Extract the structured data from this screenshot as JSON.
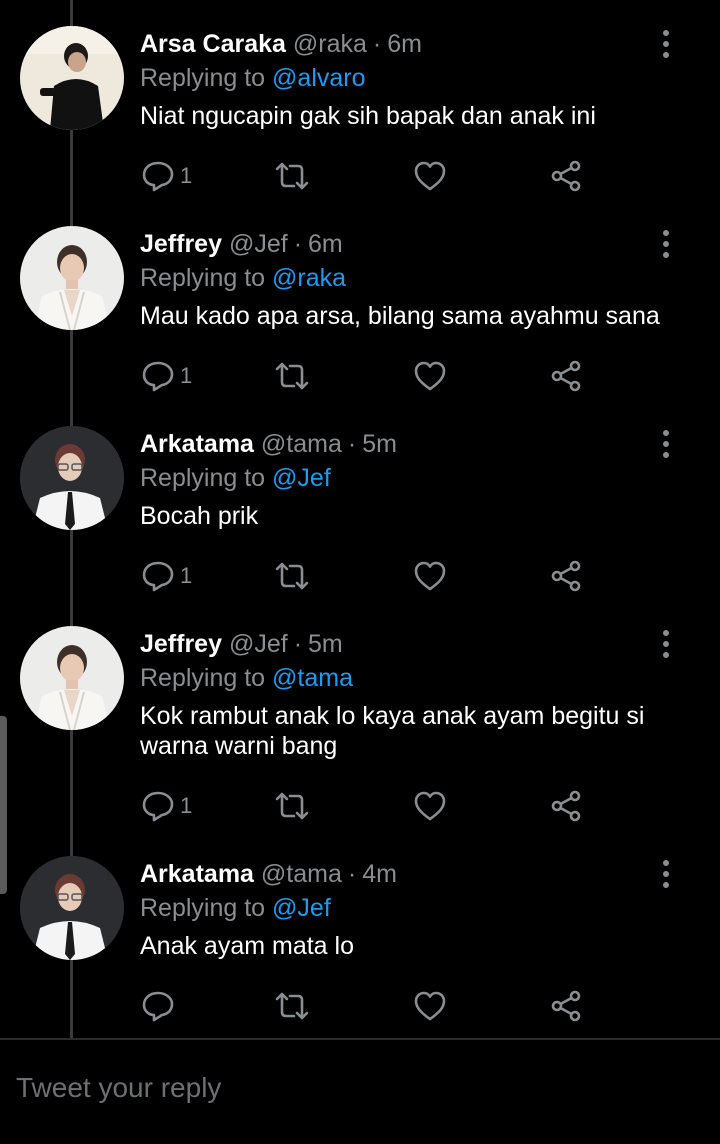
{
  "tweets": [
    {
      "name": "Arsa Caraka",
      "handle": "@raka",
      "time": "6m",
      "reply_prefix": "Replying to",
      "reply_to": "@alvaro",
      "text": "Niat ngucapin gak sih bapak dan anak ini",
      "reply_count": "1",
      "avatar": "photo-dark"
    },
    {
      "name": "Jeffrey",
      "handle": "@Jef",
      "time": "6m",
      "reply_prefix": "Replying to",
      "reply_to": "@raka",
      "text": "Mau kado apa arsa, bilang sama ayahmu sana",
      "reply_count": "1",
      "avatar": "photo-light"
    },
    {
      "name": "Arkatama",
      "handle": "@tama",
      "time": "5m",
      "reply_prefix": "Replying to",
      "reply_to": "@Jef",
      "text": "Bocah prik",
      "reply_count": "1",
      "avatar": "photo-suit"
    },
    {
      "name": "Jeffrey",
      "handle": "@Jef",
      "time": "5m",
      "reply_prefix": "Replying to",
      "reply_to": "@tama",
      "text": "Kok rambut anak lo kaya anak ayam begitu si warna warni bang",
      "reply_count": "1",
      "avatar": "photo-light"
    },
    {
      "name": "Arkatama",
      "handle": "@tama",
      "time": "4m",
      "reply_prefix": "Replying to",
      "reply_to": "@Jef",
      "text": "Anak ayam mata lo",
      "reply_count": "",
      "avatar": "photo-suit"
    }
  ],
  "separator": "·",
  "composer": {
    "placeholder": "Tweet your reply"
  },
  "colors": {
    "background": "#000000",
    "accent": "#1d9bf0",
    "muted": "#8a8d91"
  },
  "icons": [
    "reply-icon",
    "retweet-icon",
    "like-icon",
    "share-icon",
    "more-icon"
  ]
}
